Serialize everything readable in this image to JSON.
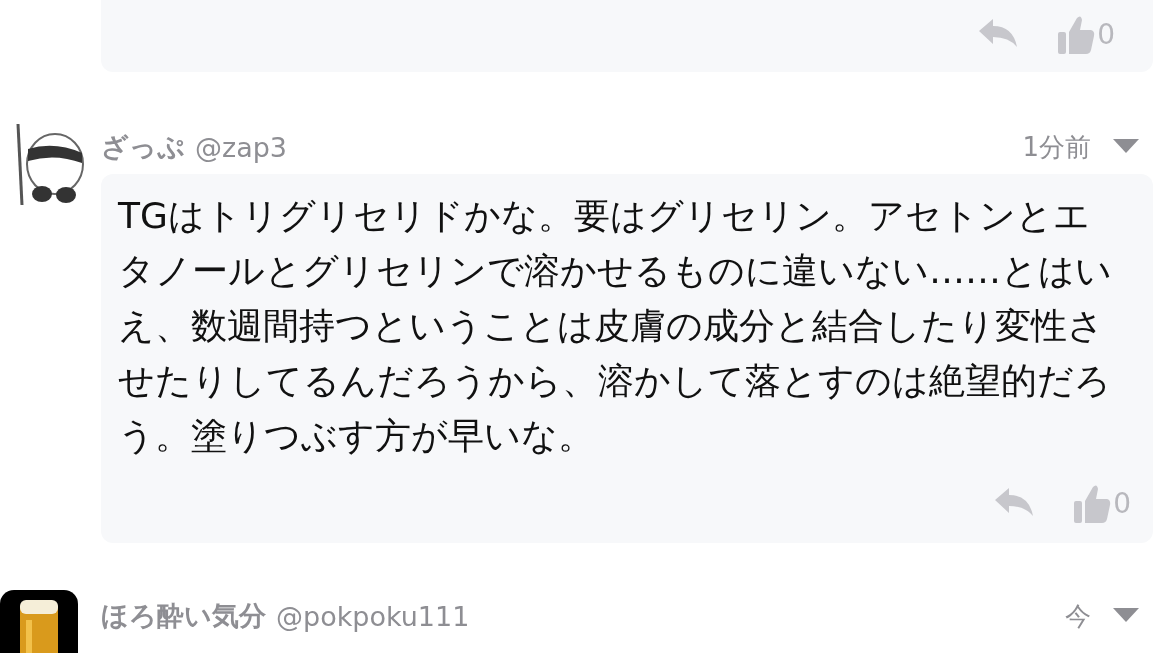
{
  "comments": [
    {
      "kind": "partial",
      "likes": "0"
    },
    {
      "kind": "full",
      "avatar": {
        "kind": "panda"
      },
      "author": "ざっぷ",
      "handle": "@zap3",
      "time": "1分前",
      "body": "TGはトリグリセリドかな。要はグリセリン。アセトンとエタノールとグリセリンで溶かせるものに違いない……とはいえ、数週間持つということは皮膚の成分と結合したり変性させたりしてるんだろうから、溶かして落とすのは絶望的だろう。塗りつぶす方が早いな。",
      "likes": "0"
    },
    {
      "kind": "header",
      "avatar": {
        "kind": "beer"
      },
      "author": "ほろ酔い気分",
      "handle": "@pokpoku111",
      "time": "今"
    }
  ]
}
